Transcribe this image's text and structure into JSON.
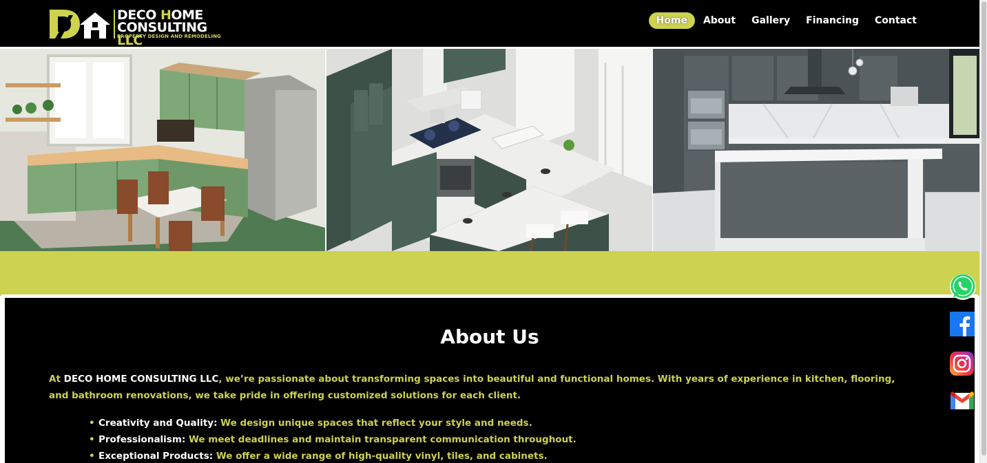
{
  "brand": {
    "line1_a": "DECO ",
    "line1_b": "H",
    "line1_c": "OME",
    "line2_a": "CONSULTING ",
    "line2_b": "LLC",
    "tagline": "PROPERTY DESIGN AND REMODELING",
    "mark": "DH"
  },
  "nav": {
    "items": [
      {
        "label": "Home",
        "active": true
      },
      {
        "label": "About",
        "active": false
      },
      {
        "label": "Gallery",
        "active": false
      },
      {
        "label": "Financing",
        "active": false
      },
      {
        "label": "Contact",
        "active": false
      }
    ]
  },
  "hero": {
    "images": [
      "isometric-green-kitchen-image",
      "isometric-dark-green-kitchen-image",
      "modern-grey-kitchen-photo"
    ]
  },
  "about": {
    "title": "About Us",
    "intro_prefix": "At ",
    "intro_brand": "DECO HOME CONSULTING LLC",
    "intro_rest": ", we’re passionate about transforming spaces into beautiful and functional homes. With years of experience in kitchen, flooring, and bathroom renovations, we take pride in offering customized solutions for each client.",
    "points": [
      {
        "key": "Creativity and Quality:",
        "text": " We design unique spaces that reflect your style and needs."
      },
      {
        "key": "Professionalism:",
        "text": " We meet deadlines and maintain transparent communication throughout."
      },
      {
        "key": "Exceptional Products:",
        "text": " We offer a wide range of high-quality vinyl, tiles, and cabinets."
      }
    ]
  },
  "social": [
    "whatsapp-icon",
    "facebook-icon",
    "instagram-icon",
    "gmail-icon"
  ],
  "colors": {
    "accent": "#cdd24f",
    "background": "#000000",
    "text_light": "#ffffff"
  }
}
